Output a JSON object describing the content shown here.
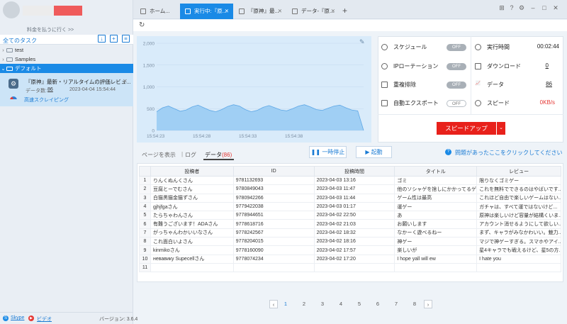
{
  "sidebar": {
    "pay_link": "料金を払うに行く >>",
    "tasks_title": "全てのタスク",
    "tree": [
      {
        "label": "test"
      },
      {
        "label": "Samples"
      },
      {
        "label": "デフォルト"
      }
    ],
    "task": {
      "name": "『原神』最新・リアルタイムの評価レビュ...",
      "count_label": "データ数:",
      "count_value": "86",
      "time": "2023-04-04 15:54:44",
      "mode": "高速スクレイピング"
    },
    "footer": {
      "skype": "Skype",
      "video": "ビデオ",
      "version": "バージョン: 3.6.4"
    }
  },
  "tabs": [
    {
      "label": "ホーム..."
    },
    {
      "label": "実行中:『原..."
    },
    {
      "label": "『原神』最..."
    },
    {
      "label": "データ-『原..."
    }
  ],
  "stats": {
    "schedule": "スケジュール",
    "schedule_toggle": "OFF",
    "ip": "IPローテーション",
    "ip_toggle": "OFF",
    "dedupe": "重複排除",
    "dedupe_toggle": "OFF",
    "export": "自動エクスポート",
    "export_toggle": "OFF",
    "runtime": "実行時間",
    "runtime_val": "00:02:44",
    "download": "ダウンロード",
    "download_val": "0",
    "data": "データ",
    "data_val": "86",
    "speed": "スピード",
    "speed_val": "0KB/s",
    "speedup_btn": "スピードアップ"
  },
  "view_tabs": {
    "page": "ページを表示",
    "log": "ログ",
    "data": "データ",
    "data_count": "(86)"
  },
  "buttons": {
    "pause": "一時停止",
    "start": "起動",
    "help": "問題があったここをクリックしてください"
  },
  "table": {
    "headers": [
      "",
      "投稿者",
      "ID",
      "投稿時間",
      "タイトル",
      "レビュー"
    ],
    "rows": [
      [
        "1",
        "りんくぬんくさん",
        "9781132693",
        "2023-04-03 13:16",
        "ゴミ",
        "限りなくゴミゲー"
      ],
      [
        "2",
        "豆腐とーでむさん",
        "9780849043",
        "2023-04-03 11:47",
        "他のソシャゲを捨しにかかってるゲ...",
        "これを無料でできるのはやばいです..."
      ],
      [
        "3",
        "白猫黒猫金猫ずさん",
        "9780942266",
        "2023-04-03 11:44",
        "ゲーム性は最高",
        "これほど自由で楽しいゲームはない..."
      ],
      [
        "4",
        "gjhjfgaさん",
        "9779422038",
        "2023-04-03 01:17",
        "運ゲー",
        "ガチャは、すべて運ではないけど..."
      ],
      [
        "5",
        "たらちゃわんさん",
        "9778944651",
        "2023-04-02 22:50",
        "あ",
        "原神は楽しいけど容量が結構くいま..."
      ],
      [
        "6",
        "有難うございます！ADAさん",
        "9778618716",
        "2023-04-02 21:03",
        "お願いします",
        "アカウント消せるようにして欲しい..."
      ],
      [
        "7",
        "がっちゃんわかいいなさん",
        "9778242567",
        "2023-04-02 18:32",
        "なかーく遊べるねー",
        "まず、キャラがみなかわいい。魅力..."
      ],
      [
        "8",
        "これ面白いよさん",
        "9778204015",
        "2023-04-02 18:16",
        "神ゲー",
        "マジで神ゲーすぎる。スマホやアイ..."
      ],
      [
        "9",
        "kinmikoさん",
        "9778160090",
        "2023-04-02 17:57",
        "楽しいが",
        "星4キャラでも戦えるけど、星5の方..."
      ],
      [
        "10",
        "невавику Supecellさん",
        "9778074234",
        "2023-04-02 17:20",
        "I hope yall will ew",
        "I hate you"
      ],
      [
        "11",
        "",
        "",
        "",
        "",
        ""
      ]
    ]
  },
  "pagination": [
    "1",
    "2",
    "3",
    "4",
    "5",
    "6",
    "7",
    "8"
  ],
  "chart_data": {
    "type": "area",
    "y_ticks": [
      "2,000",
      "1,500",
      "1,000",
      "500",
      "0"
    ],
    "x_ticks": [
      "15:54:23",
      "15:54:28",
      "15:54:33",
      "15:54:38"
    ],
    "ylim": [
      0,
      2000
    ],
    "values": [
      430,
      520,
      560,
      500,
      440,
      470,
      540,
      580,
      520,
      460,
      430,
      480,
      550,
      590,
      560,
      480,
      430,
      460,
      530,
      570,
      520,
      470,
      450,
      500,
      560,
      590,
      540,
      480,
      460,
      510,
      560,
      580,
      520,
      470,
      450,
      0
    ],
    "color": "#8cc5f2"
  }
}
